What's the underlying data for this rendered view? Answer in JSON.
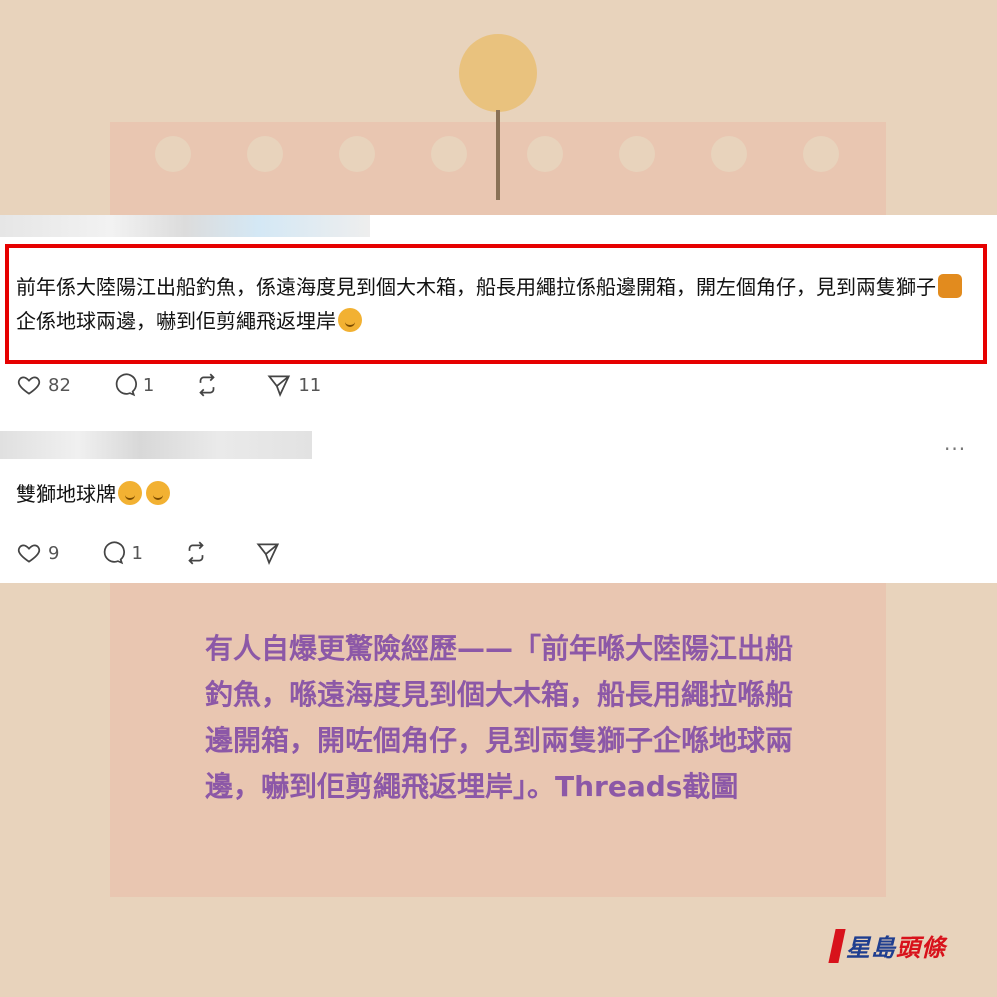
{
  "post1": {
    "text_a": "前年係大陸陽江出船釣魚，係遠海度見到個大木箱，船長用繩拉係船邊開箱，開左個角仔，見到兩隻獅子",
    "text_b": "企係地球兩邊，嚇到佢剪繩飛返埋岸",
    "likes": "82",
    "replies": "1",
    "shares": "11"
  },
  "post2": {
    "text": "雙獅地球牌",
    "likes": "9",
    "replies": "1",
    "more": "···"
  },
  "caption": "有人自爆更驚險經歷——「前年喺大陸陽江出船釣魚，喺遠海度見到個大木箱，船長用繩拉喺船邊開箱，開咗個角仔，見到兩隻獅子企喺地球兩邊，嚇到佢剪繩飛返埋岸」。Threads截圖",
  "logo": {
    "blue_text": "星島",
    "red_text": "頭條"
  },
  "icons": [
    "heart-icon",
    "comment-icon",
    "repost-icon",
    "send-icon",
    "lion-emoji",
    "smile-emoji",
    "more-icon"
  ],
  "colors": {
    "highlight": "#e60000",
    "caption": "#8c58a7",
    "background": "#e8d3bc"
  }
}
